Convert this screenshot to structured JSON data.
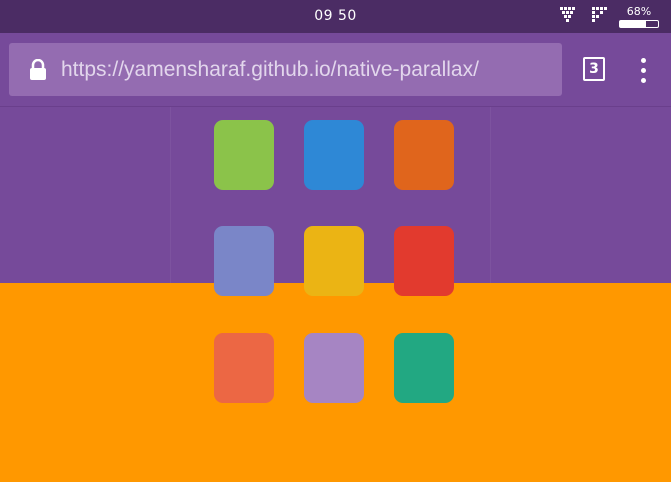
{
  "status_bar": {
    "time": "09 50",
    "battery_percent": "68%",
    "battery_level": 0.68,
    "icons": [
      "signal-icon",
      "signal-icon",
      "battery-icon"
    ]
  },
  "browser": {
    "url_host": "https://yamensharaf.github.io",
    "url_path": "/native-parallax/",
    "tab_count": "3",
    "icons": [
      "lock-icon",
      "overflow-menu-icon"
    ]
  },
  "colors": {
    "status_bar": "#4b2c64",
    "toolbar": "#764a9a",
    "url_box": "#946cb1",
    "band_top": "#764a9a",
    "band_bottom": "#ff9800"
  },
  "tiles": [
    {
      "color": "#8bc34a"
    },
    {
      "color": "#2e88d6"
    },
    {
      "color": "#e0651c"
    },
    {
      "color": "#7a86c8"
    },
    {
      "color": "#ebb414"
    },
    {
      "color": "#e23a2e"
    },
    {
      "color": "#ec6744"
    },
    {
      "color": "#a685c3"
    },
    {
      "color": "#22a882"
    }
  ]
}
